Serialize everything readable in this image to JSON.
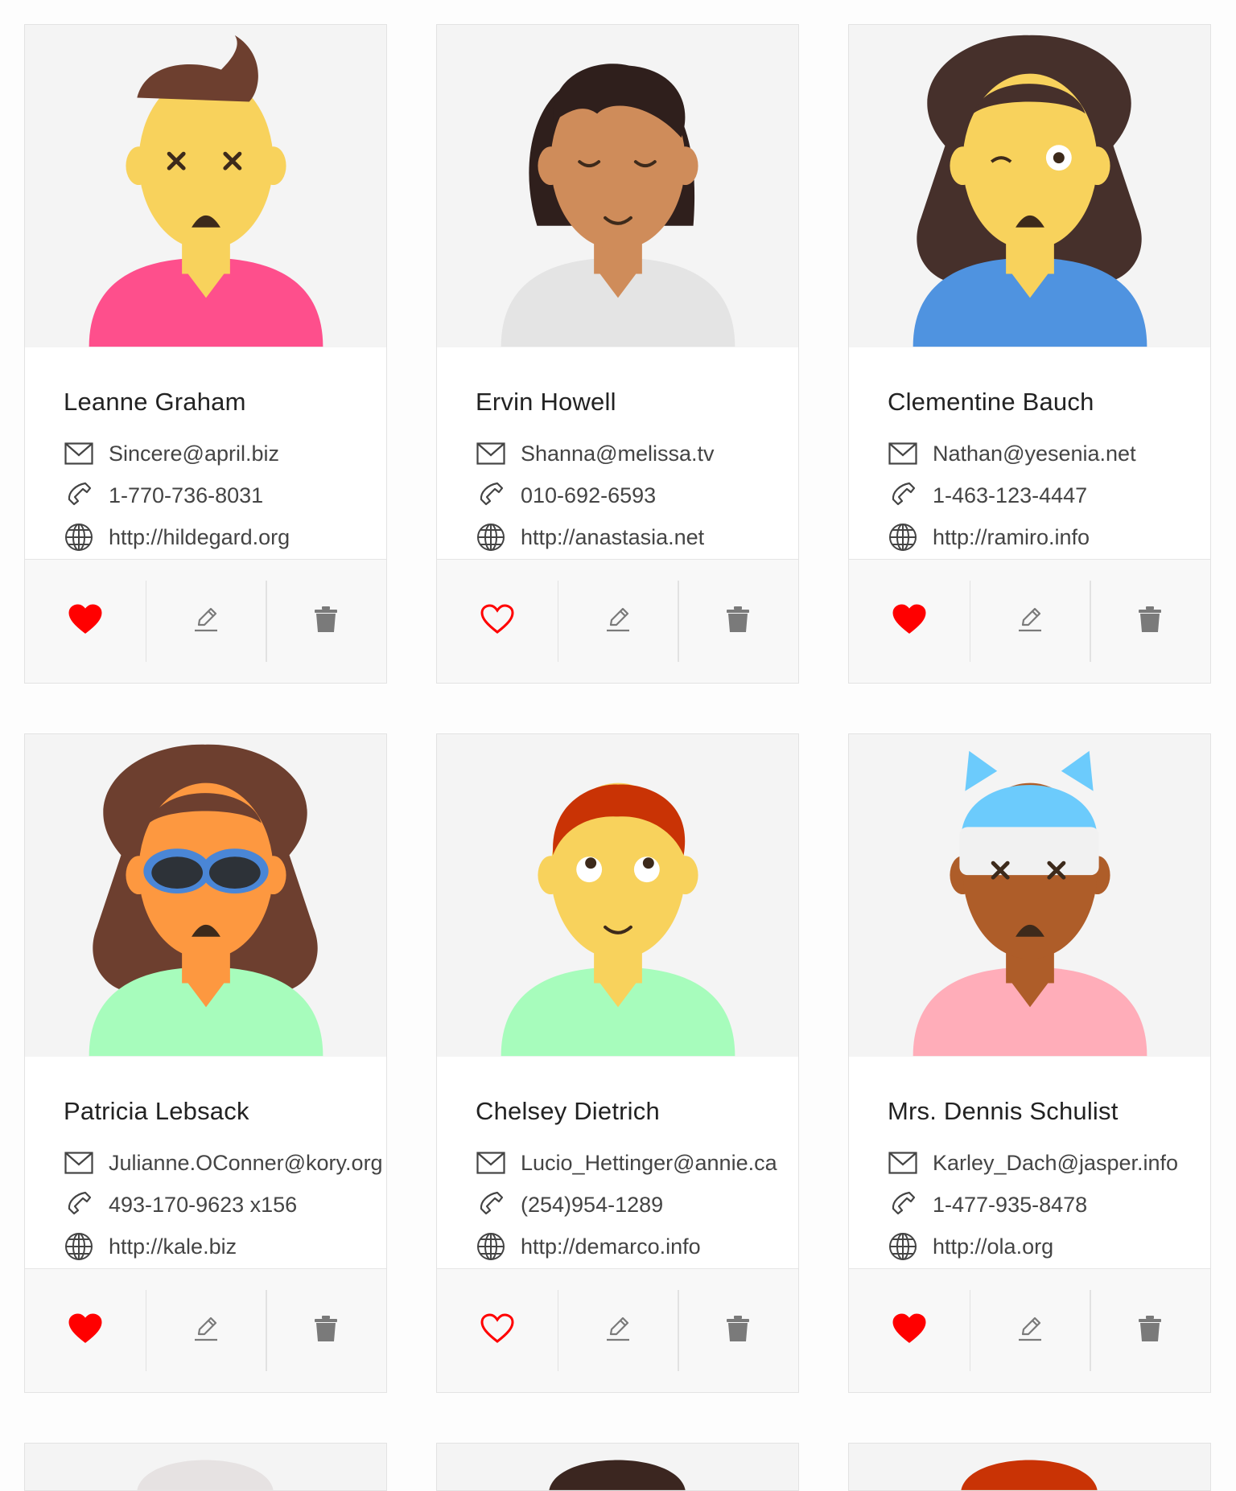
{
  "users": [
    {
      "name": "Leanne Graham",
      "email": "Sincere@april.biz",
      "phone": "1-770-736-8031",
      "website": "http://hildegard.org",
      "liked": true,
      "avatar": {
        "skin": "#f8d25c",
        "hair": "#6d3f2f",
        "shirt": "#fe4f8c"
      }
    },
    {
      "name": "Ervin Howell",
      "email": "Shanna@melissa.tv",
      "phone": "010-692-6593",
      "website": "http://anastasia.net",
      "liked": false,
      "avatar": {
        "skin": "#cf8c5a",
        "hair": "#2f1f1c",
        "shirt": "#e4e4e4"
      }
    },
    {
      "name": "Clementine Bauch",
      "email": "Nathan@yesenia.net",
      "phone": "1-463-123-4447",
      "website": "http://ramiro.info",
      "liked": true,
      "avatar": {
        "skin": "#f8d25c",
        "hair": "#46302b",
        "shirt": "#4f93e0"
      }
    },
    {
      "name": "Patricia Lebsack",
      "email": "Julianne.OConner@kory.org",
      "phone": "493-170-9623 x156",
      "website": "http://kale.biz",
      "liked": true,
      "avatar": {
        "skin": "#fd9840",
        "hair": "#6d3f2f",
        "shirt": "#a7fcbc"
      }
    },
    {
      "name": "Chelsey Dietrich",
      "email": "Lucio_Hettinger@annie.ca",
      "phone": "(254)954-1289",
      "website": "http://demarco.info",
      "liked": false,
      "avatar": {
        "skin": "#f8d25c",
        "hair": "#c93305",
        "shirt": "#a7fcbc"
      }
    },
    {
      "name": "Mrs. Dennis Schulist",
      "email": "Karley_Dach@jasper.info",
      "phone": "1-477-935-8478",
      "website": "http://ola.org",
      "liked": true,
      "avatar": {
        "skin": "#ae5d29",
        "hair": "#2f1f1c",
        "shirt": "#ffadb9"
      }
    }
  ],
  "partial_cards": [
    {
      "hair": "#e6e2e2"
    },
    {
      "hair": "#3b2620"
    },
    {
      "hair": "#c93305"
    }
  ],
  "colors": {
    "like": "#ff0000",
    "icon": "#7a7a7a"
  }
}
